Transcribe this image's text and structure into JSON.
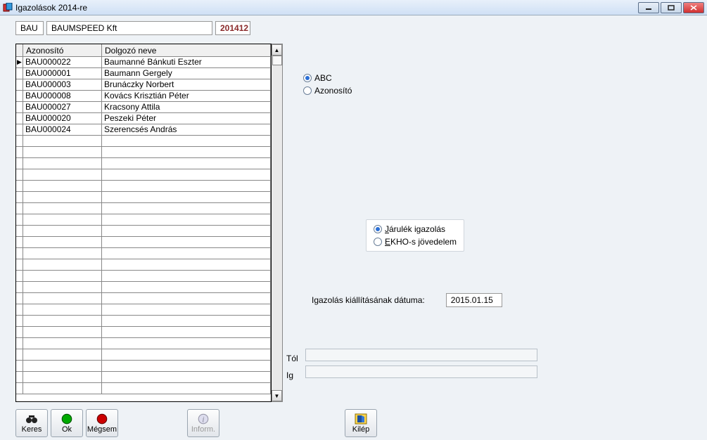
{
  "window": {
    "title": "Igazolások 2014-re"
  },
  "company": {
    "code": "BAU",
    "name": "BAUMSPEED Kft",
    "period": "201412"
  },
  "table": {
    "columns": {
      "id": "Azonosító",
      "name": "Dolgozó neve"
    },
    "rows": [
      {
        "id": "BAU000022",
        "name": "Baumanné Bánkuti Eszter",
        "selected": true
      },
      {
        "id": "BAU000001",
        "name": "Baumann Gergely"
      },
      {
        "id": "BAU000003",
        "name": "Brunáczky Norbert"
      },
      {
        "id": "BAU000008",
        "name": "Kovács Krisztián Péter"
      },
      {
        "id": "BAU000027",
        "name": "Kracsony Attila"
      },
      {
        "id": "BAU000020",
        "name": "Peszeki Péter"
      },
      {
        "id": "BAU000024",
        "name": "Szerencsés András"
      }
    ],
    "empty_rows": 23
  },
  "sort": {
    "options": [
      {
        "label": "ABC",
        "selected": true
      },
      {
        "label": "Azonosító",
        "selected": false
      }
    ]
  },
  "cert_type": {
    "options": [
      {
        "label": "Járulék igazolás",
        "underline_index": 0,
        "selected": true
      },
      {
        "label": "EKHO-s jövedelem",
        "underline_index": 0,
        "selected": false
      }
    ]
  },
  "issue_date": {
    "label": "Igazolás kiállításának dátuma:",
    "value": "2015.01.15"
  },
  "range": {
    "from_label": "Tól",
    "to_label": "Ig",
    "from_value": "",
    "to_value": ""
  },
  "buttons": {
    "keres": "Keres",
    "ok": "Ok",
    "megsem": "Mégsem",
    "inform": "Inform.",
    "kilep": "Kilép"
  }
}
